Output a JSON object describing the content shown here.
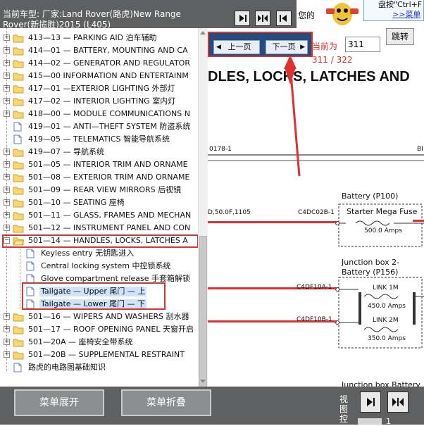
{
  "header": {
    "line1": "当前车型: 厂家:Land Rover(路虎)New Range",
    "line2": "Rover(新揽胜)2015  (L405)",
    "top_right_text": "您的"
  },
  "promo": {
    "line1": "盘按\"Ctrl+F",
    "line2": ">>菜单"
  },
  "tree": {
    "items": [
      {
        "label": "413—13 — PARKING AID 泊车辅助"
      },
      {
        "label": "414—01 — BATTERY, MOUNTING AND CA"
      },
      {
        "label": "414—02 — GENERATOR AND REGULATOR"
      },
      {
        "label": "415—00 INFORMATION AND ENTERTAINM"
      },
      {
        "label": "417—01 —EXTERIOR LIGHTING 外部灯"
      },
      {
        "label": "417—02 — INTERIOR LIGHTING 室内灯"
      },
      {
        "label": "418—00 — MODULE COMMUNICATIONS N"
      },
      {
        "label": "419—01 — ANTI—THEFT SYSTEM 防盗系统"
      },
      {
        "label": "419—05 — TELEMATICS 智能导航系统"
      },
      {
        "label": "419—07 — 导航系统"
      },
      {
        "label": "501—05 — INTERIOR TRIM AND ORNAME"
      },
      {
        "label": "501—08 — EXTERIOR TRIM AND ORNAME"
      },
      {
        "label": "501—09 — REAR VIEW MIRRORS 后视镜"
      },
      {
        "label": "501—10 — SEATING 座椅"
      },
      {
        "label": "501—11 — GLASS, FRAMES AND MECHAN"
      },
      {
        "label": "501—12 — INSTRUMENT PANEL AND CON"
      },
      {
        "label": "501—14 — HANDLES, LOCKS, LATCHES A"
      },
      {
        "label": "Keyless entry 无钥匙进入"
      },
      {
        "label": "Central locking system 中控锁系统"
      },
      {
        "label": "Glove compartment release 手套箱解锁"
      },
      {
        "label": "Tailgate — Upper 尾门 — 上"
      },
      {
        "label": "Tailgate — Lower 尾门 — 下"
      },
      {
        "label": "501—16 — WIPERS AND WASHERS 刮水器"
      },
      {
        "label": "501—17 — ROOF OPENING PANEL 天窗开启"
      },
      {
        "label": "501—20A — 座椅安全带系统"
      },
      {
        "label": "501—20B — SUPPLEMENTAL RESTRAINT"
      },
      {
        "label": "路虎的电路图基础知识"
      }
    ]
  },
  "viewer": {
    "prev_label": "上一页",
    "next_label": "下一页",
    "current_page_label": "当前为",
    "current_page_value": "311",
    "jump_label": "跳转",
    "page_count": "311 / 322",
    "title": "DLES, LOCKS, LATCHES AND",
    "ref_left": "0178-1",
    "ref_right": "BI"
  },
  "diagram": {
    "battery_label": "Battery (P100)",
    "starter_fuse_label": "Starter Mega Fuse",
    "starter_fuse_amps": "500.0 Amps",
    "wire_spec": "D,50.0F,1105",
    "conn_1": "C4DC02B-1",
    "junction_label_1": "Junction box 2-",
    "junction_label_2": "Battery (P156)",
    "conn_2": "C4DF10A-1",
    "link1_label": "LINK 1M",
    "link1_amps": "450.0 Amps",
    "conn_3": "C4DF10B-1",
    "link2_label": "LINK 2M",
    "link2_amps": "350.0 Amps",
    "bottom_text": "Junction box  Battery"
  },
  "bottom": {
    "expand_label": "菜单展开",
    "collapse_label": "菜单折叠",
    "view_label_1": "视",
    "view_label_2": "图",
    "view_label_3": "控",
    "mini_number": "1"
  },
  "colors": {
    "accent_red": "#e03030",
    "nav_blue": "#244d7d",
    "header_gray": "#5f6061"
  }
}
